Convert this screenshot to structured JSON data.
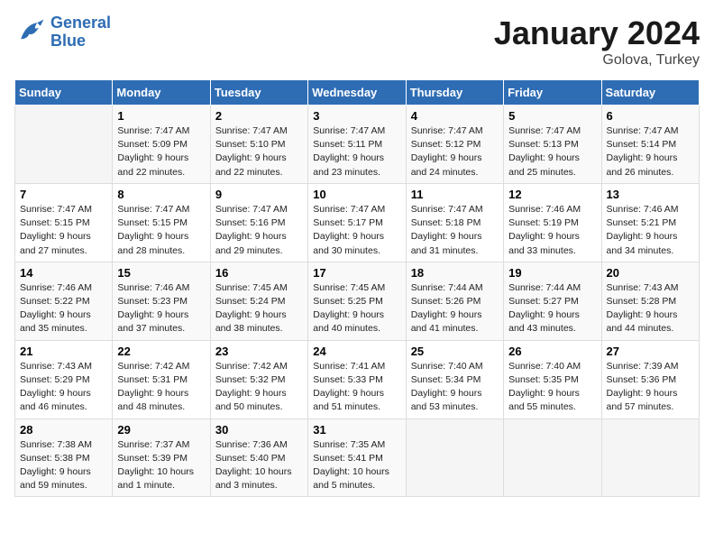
{
  "header": {
    "logo_line1": "General",
    "logo_line2": "Blue",
    "month": "January 2024",
    "location": "Golova, Turkey"
  },
  "weekdays": [
    "Sunday",
    "Monday",
    "Tuesday",
    "Wednesday",
    "Thursday",
    "Friday",
    "Saturday"
  ],
  "weeks": [
    [
      {
        "day": "",
        "info": ""
      },
      {
        "day": "1",
        "info": "Sunrise: 7:47 AM\nSunset: 5:09 PM\nDaylight: 9 hours\nand 22 minutes."
      },
      {
        "day": "2",
        "info": "Sunrise: 7:47 AM\nSunset: 5:10 PM\nDaylight: 9 hours\nand 22 minutes."
      },
      {
        "day": "3",
        "info": "Sunrise: 7:47 AM\nSunset: 5:11 PM\nDaylight: 9 hours\nand 23 minutes."
      },
      {
        "day": "4",
        "info": "Sunrise: 7:47 AM\nSunset: 5:12 PM\nDaylight: 9 hours\nand 24 minutes."
      },
      {
        "day": "5",
        "info": "Sunrise: 7:47 AM\nSunset: 5:13 PM\nDaylight: 9 hours\nand 25 minutes."
      },
      {
        "day": "6",
        "info": "Sunrise: 7:47 AM\nSunset: 5:14 PM\nDaylight: 9 hours\nand 26 minutes."
      }
    ],
    [
      {
        "day": "7",
        "info": "Sunrise: 7:47 AM\nSunset: 5:15 PM\nDaylight: 9 hours\nand 27 minutes."
      },
      {
        "day": "8",
        "info": "Sunrise: 7:47 AM\nSunset: 5:15 PM\nDaylight: 9 hours\nand 28 minutes."
      },
      {
        "day": "9",
        "info": "Sunrise: 7:47 AM\nSunset: 5:16 PM\nDaylight: 9 hours\nand 29 minutes."
      },
      {
        "day": "10",
        "info": "Sunrise: 7:47 AM\nSunset: 5:17 PM\nDaylight: 9 hours\nand 30 minutes."
      },
      {
        "day": "11",
        "info": "Sunrise: 7:47 AM\nSunset: 5:18 PM\nDaylight: 9 hours\nand 31 minutes."
      },
      {
        "day": "12",
        "info": "Sunrise: 7:46 AM\nSunset: 5:19 PM\nDaylight: 9 hours\nand 33 minutes."
      },
      {
        "day": "13",
        "info": "Sunrise: 7:46 AM\nSunset: 5:21 PM\nDaylight: 9 hours\nand 34 minutes."
      }
    ],
    [
      {
        "day": "14",
        "info": "Sunrise: 7:46 AM\nSunset: 5:22 PM\nDaylight: 9 hours\nand 35 minutes."
      },
      {
        "day": "15",
        "info": "Sunrise: 7:46 AM\nSunset: 5:23 PM\nDaylight: 9 hours\nand 37 minutes."
      },
      {
        "day": "16",
        "info": "Sunrise: 7:45 AM\nSunset: 5:24 PM\nDaylight: 9 hours\nand 38 minutes."
      },
      {
        "day": "17",
        "info": "Sunrise: 7:45 AM\nSunset: 5:25 PM\nDaylight: 9 hours\nand 40 minutes."
      },
      {
        "day": "18",
        "info": "Sunrise: 7:44 AM\nSunset: 5:26 PM\nDaylight: 9 hours\nand 41 minutes."
      },
      {
        "day": "19",
        "info": "Sunrise: 7:44 AM\nSunset: 5:27 PM\nDaylight: 9 hours\nand 43 minutes."
      },
      {
        "day": "20",
        "info": "Sunrise: 7:43 AM\nSunset: 5:28 PM\nDaylight: 9 hours\nand 44 minutes."
      }
    ],
    [
      {
        "day": "21",
        "info": "Sunrise: 7:43 AM\nSunset: 5:29 PM\nDaylight: 9 hours\nand 46 minutes."
      },
      {
        "day": "22",
        "info": "Sunrise: 7:42 AM\nSunset: 5:31 PM\nDaylight: 9 hours\nand 48 minutes."
      },
      {
        "day": "23",
        "info": "Sunrise: 7:42 AM\nSunset: 5:32 PM\nDaylight: 9 hours\nand 50 minutes."
      },
      {
        "day": "24",
        "info": "Sunrise: 7:41 AM\nSunset: 5:33 PM\nDaylight: 9 hours\nand 51 minutes."
      },
      {
        "day": "25",
        "info": "Sunrise: 7:40 AM\nSunset: 5:34 PM\nDaylight: 9 hours\nand 53 minutes."
      },
      {
        "day": "26",
        "info": "Sunrise: 7:40 AM\nSunset: 5:35 PM\nDaylight: 9 hours\nand 55 minutes."
      },
      {
        "day": "27",
        "info": "Sunrise: 7:39 AM\nSunset: 5:36 PM\nDaylight: 9 hours\nand 57 minutes."
      }
    ],
    [
      {
        "day": "28",
        "info": "Sunrise: 7:38 AM\nSunset: 5:38 PM\nDaylight: 9 hours\nand 59 minutes."
      },
      {
        "day": "29",
        "info": "Sunrise: 7:37 AM\nSunset: 5:39 PM\nDaylight: 10 hours\nand 1 minute."
      },
      {
        "day": "30",
        "info": "Sunrise: 7:36 AM\nSunset: 5:40 PM\nDaylight: 10 hours\nand 3 minutes."
      },
      {
        "day": "31",
        "info": "Sunrise: 7:35 AM\nSunset: 5:41 PM\nDaylight: 10 hours\nand 5 minutes."
      },
      {
        "day": "",
        "info": ""
      },
      {
        "day": "",
        "info": ""
      },
      {
        "day": "",
        "info": ""
      }
    ]
  ]
}
